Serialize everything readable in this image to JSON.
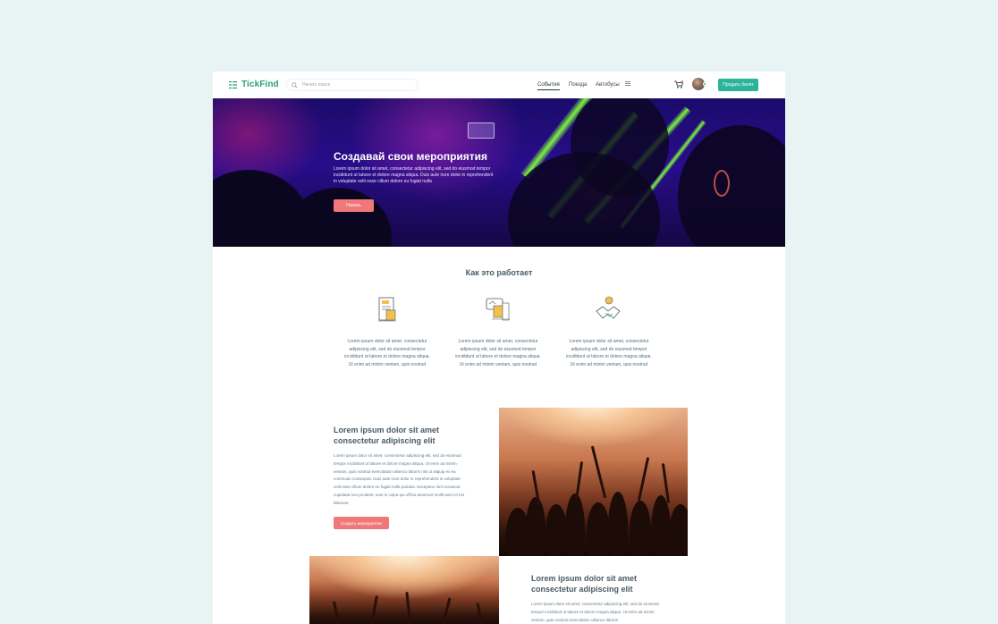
{
  "header": {
    "logo_text": "TickFind",
    "search_placeholder": "Начать поиск",
    "nav": {
      "events": "События",
      "trains": "Поезда",
      "buses": "Автобусы"
    },
    "sell_button": "Продать билет",
    "accent": "#2bb498"
  },
  "hero": {
    "title": "Создавай свои мероприятия",
    "text": "Lorem ipsum dolor sit amet, consectetur adipiscing elit, sed do eiusmod tempor incididunt ut labore et dolore magna aliqua. Duis aute irure dolor in reprehenderit in voluptate velit esse cillum dolore eu fugiat nulla",
    "button": "Начать",
    "button_color": "#f0787a"
  },
  "how": {
    "title": "Как это работает",
    "steps": [
      {
        "icon": "document-icon",
        "text": "Lorem ipsum dolor sit amet, consectetur adipiscing elit, sed do eiusmod tempor incididunt ut labore et dolore magna aliqua. Ut enim ad minim veniam, quis nostrud"
      },
      {
        "icon": "payment-terminal-icon",
        "text": "Lorem ipsum dolor sit amet, consectetur adipiscing elit, sed do eiusmod tempor incididunt ut labore et dolore magna aliqua. Ut enim ad minim veniam, quis nostrud"
      },
      {
        "icon": "handshake-icon",
        "text": "Lorem ipsum dolor sit amet, consectetur adipiscing elit, sed do eiusmod tempor incididunt ut labore et dolore magna aliqua. Ut enim ad minim veniam, quis nostrud"
      }
    ]
  },
  "features": [
    {
      "title": "Lorem ipsum dolor sit amet consectetur adipiscing elit",
      "text": "Lorem ipsum dolor sit amet, consectetur adipiscing elit, sed do eiusmod tempor incididunt ut labore et dolore magna aliqua. Ut enim ad minim veniam, quis nostrud exercitation ullamco laboris nisi ut aliquip ex ea commodo consequat. Duis aute irure dolor in reprehenderit in voluptate velit esse cillum dolore eu fugiat nulla pariatur. Excepteur sint occaecat cupidatat non proident, sunt in culpa qui officia deserunt mollit anim id est laborum.",
      "button": "Создать мероприятие"
    },
    {
      "title": "Lorem ipsum dolor sit amet consectetur adipiscing elit",
      "text": "Lorem ipsum dolor sit amet, consectetur adipiscing elit, sed do eiusmod tempor incididunt ut labore et dolore magna aliqua. Ut enim ad minim veniam, quis nostrud exercitation ullamco laboris"
    }
  ]
}
